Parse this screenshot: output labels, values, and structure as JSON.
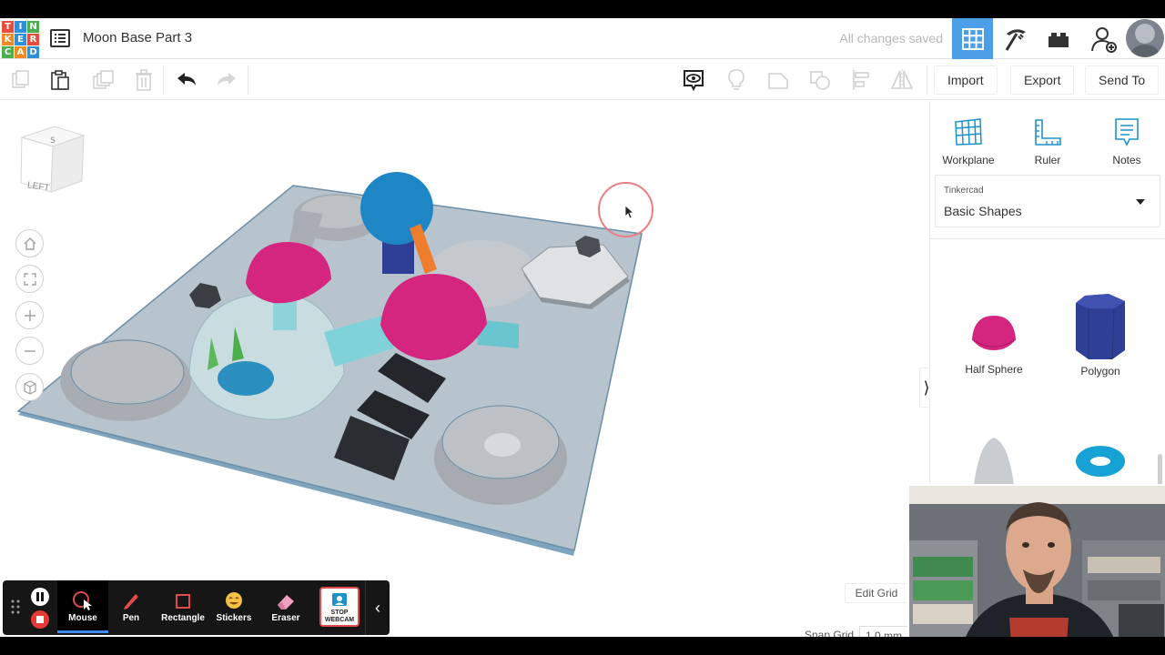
{
  "logo": {
    "letters": [
      "T",
      "I",
      "N",
      "K",
      "E",
      "R",
      "C",
      "A",
      "D"
    ],
    "colors": [
      "#e84c3d",
      "#2f8fd8",
      "#4cae4c",
      "#f08a24",
      "#2f8fd8",
      "#e84c3d",
      "#4cae4c",
      "#f08a24",
      "#2f8fd8"
    ]
  },
  "header": {
    "design_title": "Moon Base Part 3",
    "save_status": "All changes saved"
  },
  "toolbar": {
    "import_label": "Import",
    "export_label": "Export",
    "send_to_label": "Send To"
  },
  "viewcube": {
    "face_label": "LEFT"
  },
  "canvas": {
    "edit_grid_label": "Edit Grid",
    "snap_grid_label": "Snap Grid",
    "snap_grid_value": "1.0 mm"
  },
  "panel": {
    "tools": [
      {
        "label": "Workplane",
        "icon": "workplane-icon"
      },
      {
        "label": "Ruler",
        "icon": "ruler-icon"
      },
      {
        "label": "Notes",
        "icon": "notes-icon"
      }
    ],
    "library_caption": "Tinkercad",
    "library_name": "Basic Shapes",
    "shapes": [
      {
        "label": "Half Sphere",
        "color": "#d4257f"
      },
      {
        "label": "Polygon",
        "color": "#2f3f96"
      },
      {
        "label": "",
        "color": "#c9cdd2"
      },
      {
        "label": "",
        "color": "#17a2d6"
      }
    ]
  },
  "annotation_bar": {
    "items": [
      {
        "label": "Mouse",
        "active": true
      },
      {
        "label": "Pen",
        "active": false
      },
      {
        "label": "Rectangle",
        "active": false
      },
      {
        "label": "Stickers",
        "active": false
      },
      {
        "label": "Eraser",
        "active": false
      }
    ],
    "stop_webcam_line1": "STOP",
    "stop_webcam_line2": "WEBCAM"
  },
  "colors": {
    "accent": "#4c9ee6",
    "magenta": "#d4257f",
    "teal": "#7fd3d8",
    "blue": "#1f86c6",
    "orange": "#ee7d2d",
    "workplane": "#b6c3cc"
  }
}
